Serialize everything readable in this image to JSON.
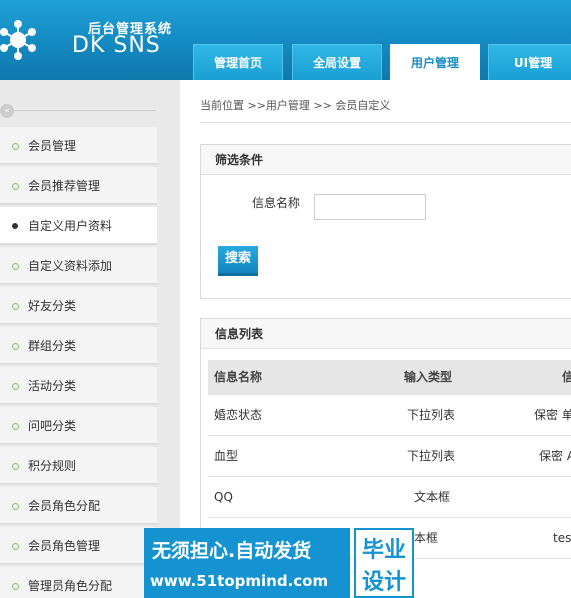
{
  "header": {
    "subtitle": "后台管理系统",
    "brand": "DK SNS"
  },
  "nav": {
    "tabs": [
      {
        "label": "管理首页"
      },
      {
        "label": "全局设置"
      },
      {
        "label": "用户管理"
      },
      {
        "label": "UI管理"
      }
    ]
  },
  "sidebar": {
    "collapse_label": "«",
    "items": [
      {
        "label": "会员管理"
      },
      {
        "label": "会员推荐管理"
      },
      {
        "label": "自定义用户资料"
      },
      {
        "label": "自定义资料添加"
      },
      {
        "label": "好友分类"
      },
      {
        "label": "群组分类"
      },
      {
        "label": "活动分类"
      },
      {
        "label": "问吧分类"
      },
      {
        "label": "积分规则"
      },
      {
        "label": "会员角色分配"
      },
      {
        "label": "会员角色管理"
      },
      {
        "label": "管理员角色分配"
      }
    ]
  },
  "breadcrumb": "当前位置 >>用户管理 >> 会员自定义",
  "filter": {
    "title": "筛选条件",
    "field_label": "信息名称",
    "field_value": "",
    "search_button": "搜索"
  },
  "list": {
    "title": "信息列表",
    "columns": [
      "信息名称",
      "输入类型",
      "信"
    ],
    "rows": [
      {
        "name": "婚恋状态",
        "type": "下拉列表",
        "extra": "保密 单"
      },
      {
        "name": "血型",
        "type": "下拉列表",
        "extra": "保密 A"
      },
      {
        "name": "QQ",
        "type": "文本框",
        "extra": ""
      },
      {
        "name": "",
        "type": "本框",
        "extra": "tes"
      }
    ]
  },
  "watermark": {
    "line1": "无须担心.自动发货",
    "line2": "www.51topmind.com",
    "right_top": "毕业",
    "right_bottom": "设计"
  }
}
